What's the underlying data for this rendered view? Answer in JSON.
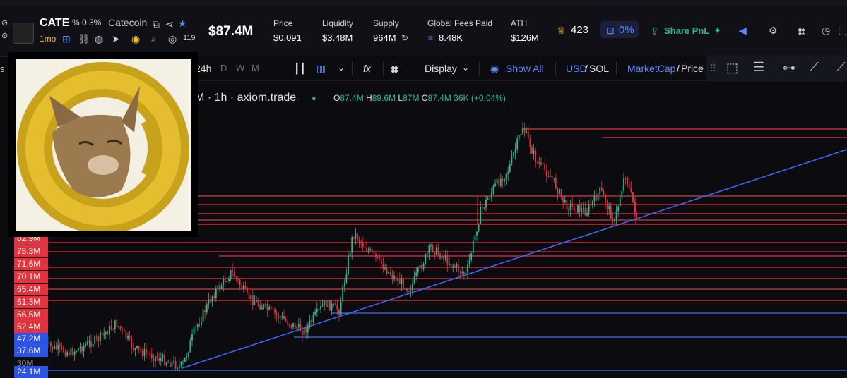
{
  "header": {
    "ticker": "CATE",
    "percent": "% 0.3%",
    "name": "Catecoin",
    "timeframe": "1mo",
    "views": "119",
    "market_cap": "$87.4M",
    "stats": [
      {
        "label": "Price",
        "value": "$0.091"
      },
      {
        "label": "Liquidity",
        "value": "$3.48M"
      },
      {
        "label": "Supply",
        "value": "964M"
      },
      {
        "label": "Global Fees Paid",
        "value": "8.48K"
      },
      {
        "label": "ATH",
        "value": "$126M"
      }
    ],
    "holders": "423",
    "lock_pct": "0%",
    "share_label": "Share PnL"
  },
  "toolbar": {
    "interval": "24h",
    "d": "D",
    "w": "W",
    "m": "M",
    "fx": "fx",
    "display": "Display",
    "show_all": "Show All",
    "usd": "USD",
    "sol": "SOL",
    "marketcap": "MarketCap",
    "price": "Price"
  },
  "legend": {
    "title": "M · 1h · axiom.trade",
    "o_label": "O",
    "o": "87.4M",
    "h_label": "H",
    "h": "89.6M",
    "l_label": "L",
    "l": "87M",
    "c_label": "C",
    "c": "87.4M",
    "vol": "36K",
    "change": "(+0.04%)"
  },
  "axis_labels": [
    {
      "text": "82.9M",
      "color": "red"
    },
    {
      "text": "75.3M",
      "color": "red"
    },
    {
      "text": "71.6M",
      "color": "red"
    },
    {
      "text": "70.1M",
      "color": "red"
    },
    {
      "text": "65.4M",
      "color": "red"
    },
    {
      "text": "61.3M",
      "color": "red"
    },
    {
      "text": "56.5M",
      "color": "red"
    },
    {
      "text": "52.4M",
      "color": "red"
    },
    {
      "text": "47.2M",
      "color": "blue"
    },
    {
      "text": "37.6M",
      "color": "blue"
    },
    {
      "text": "30M",
      "color": "plain"
    },
    {
      "text": "24.1M",
      "color": "blue"
    }
  ],
  "colors": {
    "up": "#2fb98a",
    "down": "#e5323f",
    "hline": "#e5323f",
    "trend": "#3b6bff",
    "accent": "#f0c419"
  },
  "icons": [
    "copy-icon",
    "share-icon",
    "star-icon",
    "users-icon",
    "link-icon",
    "globe-icon",
    "telegram-icon",
    "search-icon",
    "eye-icon",
    "crown-icon",
    "lock-icon",
    "share-icon",
    "pin-icon",
    "megaphone-icon",
    "gear-icon",
    "chart-icon",
    "clock-icon"
  ]
}
